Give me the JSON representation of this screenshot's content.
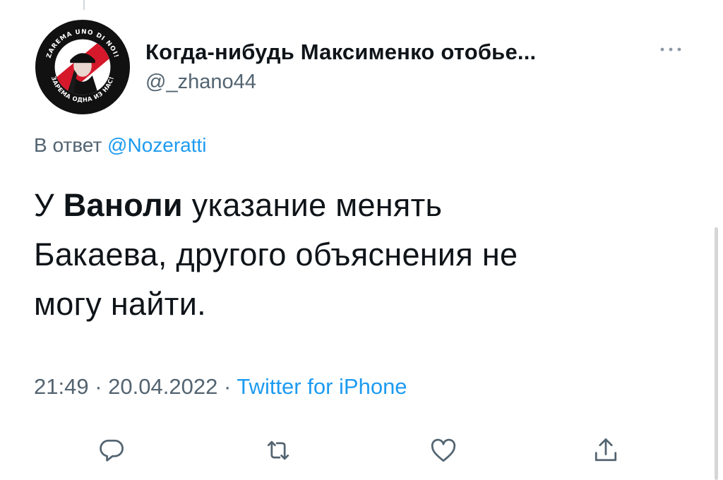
{
  "tweet": {
    "display_name": "Когда-нибудь Максименко отобье...",
    "handle": "@_zhano44",
    "reply_prefix": "В ответ",
    "reply_mention": "@Nozeratti",
    "text_line1_start": "У",
    "text_line1_bold": "Ваноли",
    "text_line1_end": "указание менять",
    "text_line2": "Бакаева, другого объяснения не",
    "text_line3": "могу найти.",
    "time": "21:49",
    "date": "20.04.2022",
    "separator": "·",
    "source": "Twitter for iPhone"
  },
  "avatar": {
    "icon": "avatar-badge",
    "ring_text_top": "ZAREMA UNO DI NOI!",
    "ring_text_bottom": "ЗАРЕМА ОДНА ИЗ НАС!",
    "colors": {
      "ring": "#111111",
      "red": "#d6182b",
      "white": "#ffffff"
    }
  },
  "actions": [
    {
      "name": "reply-icon"
    },
    {
      "name": "retweet-icon"
    },
    {
      "name": "like-icon"
    },
    {
      "name": "share-icon"
    }
  ],
  "colors": {
    "text": "#0f1419",
    "secondary": "#536471",
    "link": "#1d9bf0",
    "icon": "#536471"
  }
}
